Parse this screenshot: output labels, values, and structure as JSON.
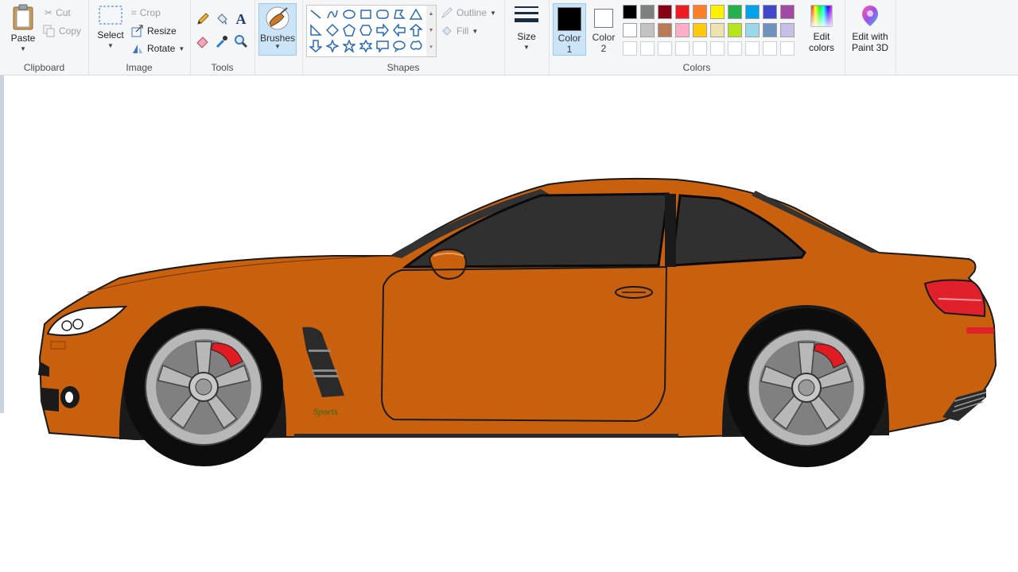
{
  "ribbon": {
    "clipboard": {
      "label": "Clipboard",
      "paste": "Paste",
      "cut": "Cut",
      "copy": "Copy"
    },
    "image": {
      "label": "Image",
      "select": "Select",
      "crop": "Crop",
      "resize": "Resize",
      "rotate": "Rotate"
    },
    "tools": {
      "label": "Tools"
    },
    "brushes": {
      "label": "Brushes"
    },
    "shapes": {
      "label": "Shapes",
      "outline": "Outline",
      "fill": "Fill"
    },
    "size": {
      "label": "Size"
    },
    "colors": {
      "label": "Colors",
      "color1_line1": "Color",
      "color1_line2": "1",
      "color2_line1": "Color",
      "color2_line2": "2",
      "edit_line1": "Edit",
      "edit_line2": "colors",
      "color1": "#000000",
      "color2": "#ffffff",
      "palette_row1": [
        "#000000",
        "#7f7f7f",
        "#880015",
        "#ed1c24",
        "#ff7f27",
        "#fff200",
        "#22b14c",
        "#00a2e8",
        "#3f48cc",
        "#a349a4"
      ],
      "palette_row2": [
        "#ffffff",
        "#c3c3c3",
        "#b97a57",
        "#ffaec9",
        "#ffc90e",
        "#efe4b0",
        "#b5e61d",
        "#99d9ea",
        "#7092be",
        "#c8bfe7"
      ],
      "palette_row3": [
        "#ffffff",
        "#ffffff",
        "#ffffff",
        "#ffffff",
        "#ffffff",
        "#ffffff",
        "#ffffff",
        "#ffffff",
        "#ffffff",
        "#ffffff"
      ]
    },
    "paint3d": {
      "line1": "Edit with",
      "line2": "Paint 3D"
    }
  },
  "canvas": {
    "drawing_text": "Sports",
    "car_body_color": "#c8600e",
    "window_color": "#303030",
    "rim_color": "#b8b8b8",
    "caliper_color": "#e11b22",
    "taillight_color": "#e0202a"
  }
}
